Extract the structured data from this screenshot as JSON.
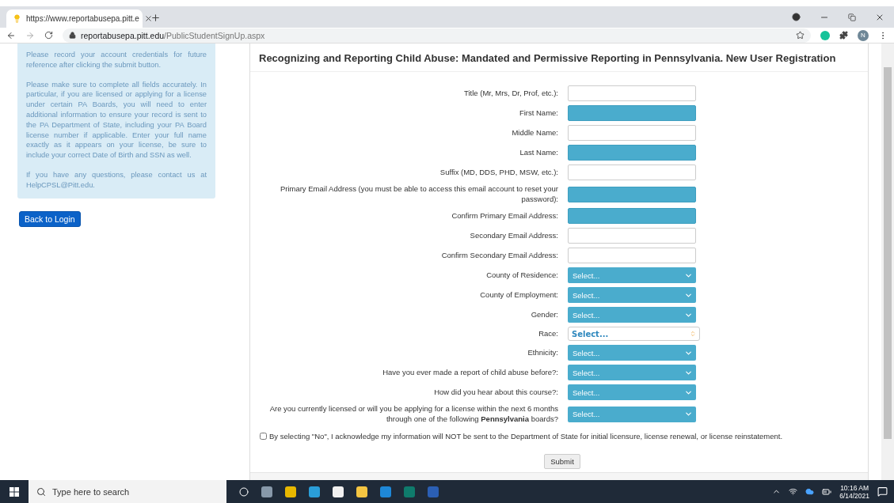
{
  "browser": {
    "tab": {
      "title": "https://www.reportabusepa.pitt.e",
      "selected": true
    },
    "url": {
      "domain": "reportabusepa.pitt.edu",
      "path": "/PublicStudentSignUp.aspx"
    },
    "profile_initial": "N"
  },
  "sidebar": {
    "paragraphs": [
      "Please record your account credentials for future reference after clicking the submit button.",
      "Please make sure to complete all fields accurately. In particular, if you are licensed or applying for a license under certain PA Boards, you will need to enter additional information to ensure your record is sent to the PA Department of State, including your PA Board license number if applicable. Enter your full name exactly as it appears on your license, be sure to include your correct Date of Birth and SSN as well.",
      "If you have any questions, please contact us at HelpCPSL@Pitt.edu."
    ],
    "back_button": "Back to Login"
  },
  "form": {
    "title": "Recognizing and Reporting Child Abuse: Mandated and Permissive Reporting in Pennsylvania. New User Registration",
    "fields": [
      {
        "label": "Title (Mr, Mrs, Dr, Prof, etc.):",
        "kind": "text",
        "required": false
      },
      {
        "label": "First Name:",
        "kind": "text",
        "required": true
      },
      {
        "label": "Middle Name:",
        "kind": "text",
        "required": false
      },
      {
        "label": "Last Name:",
        "kind": "text",
        "required": true
      },
      {
        "label": "Suffix (MD, DDS, PHD, MSW, etc.):",
        "kind": "text",
        "required": false
      },
      {
        "label": "Primary Email Address (you must be able to access this email account to reset your password):",
        "kind": "text",
        "required": true
      },
      {
        "label": "Confirm Primary Email Address:",
        "kind": "text",
        "required": true
      },
      {
        "label": "Secondary Email Address:",
        "kind": "text",
        "required": false
      },
      {
        "label": "Confirm Secondary Email Address:",
        "kind": "text",
        "required": false
      },
      {
        "label": "County of Residence:",
        "kind": "select",
        "value": "Select..."
      },
      {
        "label": "County of Employment:",
        "kind": "select",
        "value": "Select..."
      },
      {
        "label": "Gender:",
        "kind": "select",
        "value": "Select..."
      },
      {
        "label": "Race:",
        "kind": "combo",
        "value": "Select..."
      },
      {
        "label": "Ethnicity:",
        "kind": "select",
        "value": "Select..."
      },
      {
        "label": "Have you ever made a report of child abuse before?:",
        "kind": "select",
        "value": "Select..."
      },
      {
        "label": "How did you hear about this course?:",
        "kind": "select",
        "value": "Select..."
      },
      {
        "label": "Are you currently licensed or will you be applying for a license within the next 6 months through one of the following **Pennsylvania** boards?",
        "kind": "select",
        "value": "Select..."
      }
    ],
    "acknowledgement": {
      "text": "By selecting \"No\", I acknowledge my information will NOT be sent to the Department of State for initial licensure, license renewal, or license reinstatement.",
      "checked": false
    },
    "submit": "Submit"
  },
  "taskbar": {
    "search_placeholder": "Type here to search",
    "time": "10:16 AM",
    "date": "6/14/2021"
  }
}
